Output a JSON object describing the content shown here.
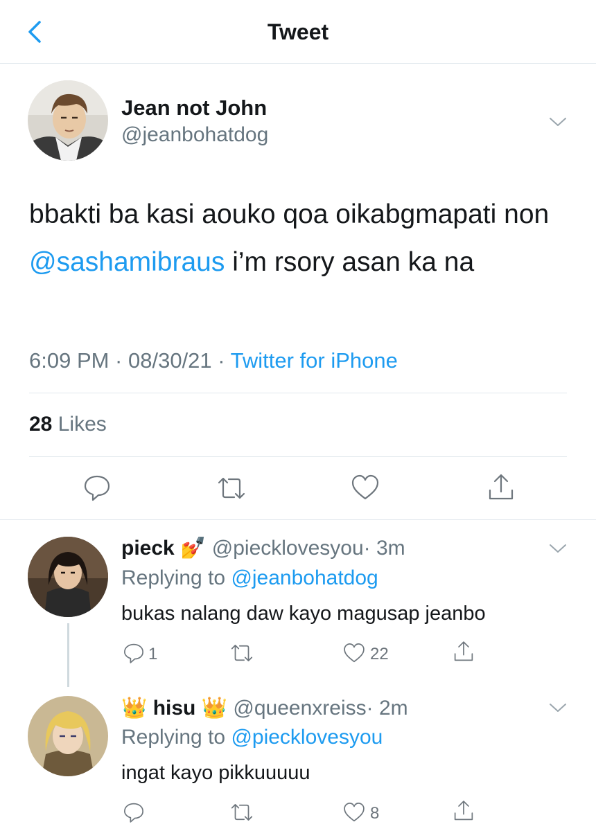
{
  "header": {
    "title": "Tweet",
    "back_icon": "chevron-left-icon"
  },
  "colors": {
    "accent": "#1d9bf0",
    "text": "#14171a",
    "muted": "#66757f",
    "divider": "#e1e8ed"
  },
  "tweet": {
    "author_name": "Jean not John",
    "author_handle": "@jeanbohatdog",
    "text_before": "bbakti ba kasi aouko qoa oikabgmapati non ",
    "mention": "@sashamibraus",
    "text_after": " i’m rsory asan ka na",
    "time": "6:09 PM · 08/30/21 · ",
    "source": "Twitter for iPhone",
    "likes_count": "28",
    "likes_label": "Likes",
    "actions": [
      "reply-icon",
      "retweet-icon",
      "like-icon",
      "share-icon"
    ]
  },
  "replies": [
    {
      "name": "pieck",
      "name_emoji": "💅",
      "handle": "@piecklovesyou",
      "time": "· 3m",
      "replying_label": "Replying to ",
      "replying_to": "@jeanbohatdog",
      "text": "bukas nalang daw kayo magusap jeanbo",
      "reply_count": "1",
      "like_count": "22"
    },
    {
      "name": "hisu",
      "name_emoji": "👑",
      "handle": "@queenxreiss",
      "time": "· 2m",
      "replying_label": "Replying to ",
      "replying_to": "@piecklovesyou",
      "text": "ingat kayo pikkuuuuu",
      "reply_count": "",
      "like_count": "8"
    }
  ]
}
